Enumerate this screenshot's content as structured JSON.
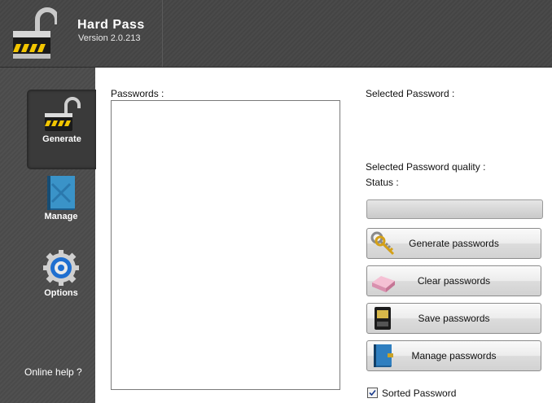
{
  "app": {
    "title": "Hard Pass",
    "version": "Version 2.0.213"
  },
  "sidebar": {
    "items": [
      {
        "label": "Generate",
        "icon": "padlock-icon",
        "active": true
      },
      {
        "label": "Manage",
        "icon": "book-icon",
        "active": false
      },
      {
        "label": "Options",
        "icon": "gear-icon",
        "active": false
      }
    ],
    "online_help": "Online help ?"
  },
  "main": {
    "passwords_label": "Passwords :",
    "selected_password_label": "Selected Password :",
    "quality_label": "Selected Password quality :",
    "status_label": "Status :",
    "quality_progress": 0,
    "buttons": [
      {
        "label": "Generate passwords",
        "icon": "keys-icon"
      },
      {
        "label": "Clear passwords",
        "icon": "eraser-icon"
      },
      {
        "label": "Save passwords",
        "icon": "disk-icon"
      },
      {
        "label": "Manage passwords",
        "icon": "book-icon"
      }
    ],
    "sorted_checkbox": {
      "label": "Sorted Password",
      "checked": true
    }
  },
  "colors": {
    "header_bg": "#474747",
    "sidebar_bg": "#4d4d4d",
    "lock_stripe_yellow": "#f2c500",
    "gear_blue": "#1f6fd0"
  }
}
